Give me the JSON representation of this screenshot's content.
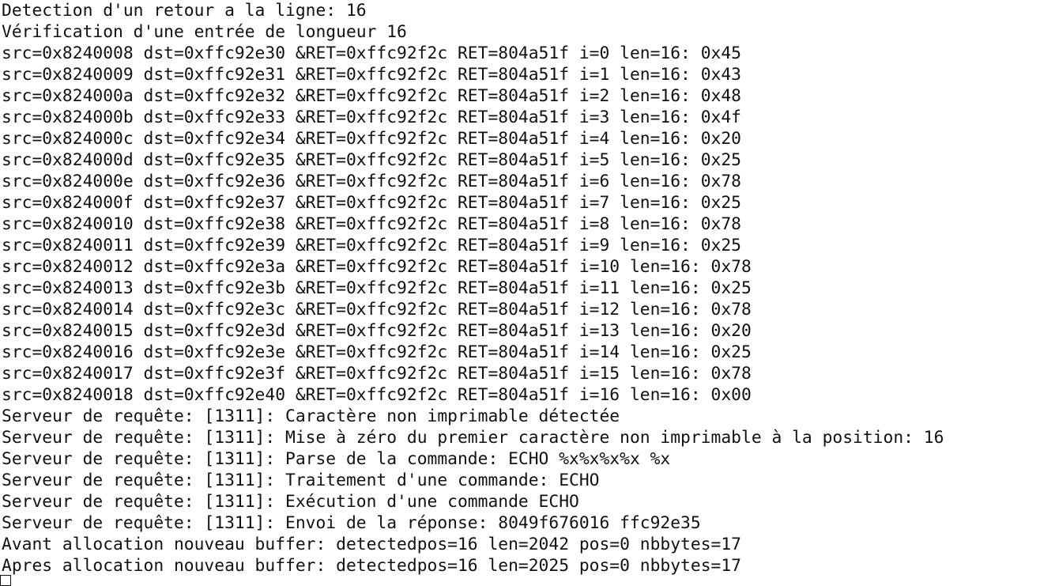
{
  "terminal": {
    "lines": [
      "Detection d'un retour a la ligne: 16",
      "Vérification d'une entrée de longueur 16",
      "src=0x8240008 dst=0xffc92e30 &RET=0xffc92f2c RET=804a51f i=0 len=16: 0x45",
      "src=0x8240009 dst=0xffc92e31 &RET=0xffc92f2c RET=804a51f i=1 len=16: 0x43",
      "src=0x824000a dst=0xffc92e32 &RET=0xffc92f2c RET=804a51f i=2 len=16: 0x48",
      "src=0x824000b dst=0xffc92e33 &RET=0xffc92f2c RET=804a51f i=3 len=16: 0x4f",
      "src=0x824000c dst=0xffc92e34 &RET=0xffc92f2c RET=804a51f i=4 len=16: 0x20",
      "src=0x824000d dst=0xffc92e35 &RET=0xffc92f2c RET=804a51f i=5 len=16: 0x25",
      "src=0x824000e dst=0xffc92e36 &RET=0xffc92f2c RET=804a51f i=6 len=16: 0x78",
      "src=0x824000f dst=0xffc92e37 &RET=0xffc92f2c RET=804a51f i=7 len=16: 0x25",
      "src=0x8240010 dst=0xffc92e38 &RET=0xffc92f2c RET=804a51f i=8 len=16: 0x78",
      "src=0x8240011 dst=0xffc92e39 &RET=0xffc92f2c RET=804a51f i=9 len=16: 0x25",
      "src=0x8240012 dst=0xffc92e3a &RET=0xffc92f2c RET=804a51f i=10 len=16: 0x78",
      "src=0x8240013 dst=0xffc92e3b &RET=0xffc92f2c RET=804a51f i=11 len=16: 0x25",
      "src=0x8240014 dst=0xffc92e3c &RET=0xffc92f2c RET=804a51f i=12 len=16: 0x78",
      "src=0x8240015 dst=0xffc92e3d &RET=0xffc92f2c RET=804a51f i=13 len=16: 0x20",
      "src=0x8240016 dst=0xffc92e3e &RET=0xffc92f2c RET=804a51f i=14 len=16: 0x25",
      "src=0x8240017 dst=0xffc92e3f &RET=0xffc92f2c RET=804a51f i=15 len=16: 0x78",
      "src=0x8240018 dst=0xffc92e40 &RET=0xffc92f2c RET=804a51f i=16 len=16: 0x00",
      "Serveur de requête: [1311]: Caractère non imprimable détectée",
      "Serveur de requête: [1311]: Mise à zéro du premier caractère non imprimable à la position: 16",
      "Serveur de requête: [1311]: Parse de la commande: ECHO %x%x%x%x %x",
      "Serveur de requête: [1311]: Traitement d'une commande: ECHO",
      "Serveur de requête: [1311]: Exécution d'une commande ECHO",
      "Serveur de requête: [1311]: Envoi de la réponse: 8049f676016 ffc92e35",
      "Avant allocation nouveau buffer: detectedpos=16 len=2042 pos=0 nbbytes=17",
      "Apres allocation nouveau buffer: detectedpos=16 len=2025 pos=0 nbbytes=17"
    ],
    "cursor_icon": "block-cursor-icon",
    "colors": {
      "background": "#ffffff",
      "foreground": "#111111"
    }
  }
}
